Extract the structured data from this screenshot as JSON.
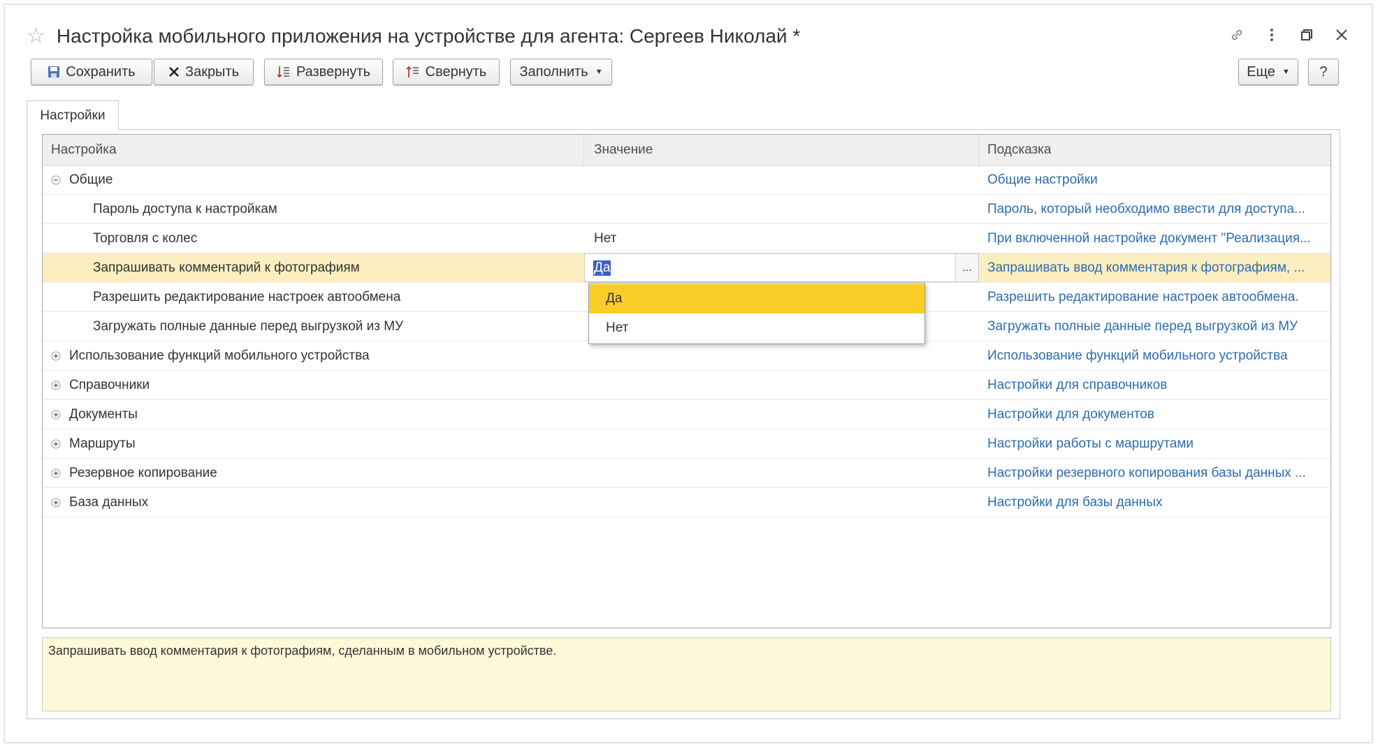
{
  "window": {
    "title": "Настройка мобильного приложения на устройстве для агента: Сергеев Николай *",
    "icons": [
      "star-icon",
      "link-icon",
      "more-vertical-icon",
      "restore-window-icon",
      "close-icon"
    ]
  },
  "toolbar": {
    "save_label": "Сохранить",
    "close_label": "Закрыть",
    "expand_label": "Развернуть",
    "collapse_label": "Свернуть",
    "fill_label": "Заполнить",
    "more_label": "Еще",
    "help_label": "?"
  },
  "tabs": [
    {
      "label": "Настройки"
    }
  ],
  "grid": {
    "columns": {
      "setting": "Настройка",
      "value": "Значение",
      "hint": "Подсказка"
    },
    "rows": [
      {
        "name": "Общие",
        "value": "",
        "hint": "Общие настройки",
        "level": 0,
        "state": "expanded"
      },
      {
        "name": "Пароль доступа к настройкам",
        "value": "",
        "hint": "Пароль, который необходимо ввести для доступа...",
        "level": 1
      },
      {
        "name": "Торговля с колес",
        "value": "Нет",
        "hint": "При включенной настройке документ \"Реализация...",
        "level": 1
      },
      {
        "name": "Запрашивать комментарий к фотографиям",
        "value": "Да",
        "hint": "Запрашивать ввод комментария к фотографиям, ...",
        "level": 1,
        "selected": true
      },
      {
        "name": "Разрешить редактирование настроек автообмена",
        "value": "",
        "hint": "Разрешить редактирование настроек автообмена.",
        "level": 1
      },
      {
        "name": "Загружать полные данные перед выгрузкой из МУ",
        "value": "",
        "hint": "Загружать полные данные перед выгрузкой из МУ",
        "level": 1
      },
      {
        "name": "Использование функций мобильного устройства",
        "value": "",
        "hint": "Использование функций мобильного устройства",
        "level": 0,
        "state": "collapsed"
      },
      {
        "name": "Справочники",
        "value": "",
        "hint": "Настройки для справочников",
        "level": 0,
        "state": "collapsed"
      },
      {
        "name": "Документы",
        "value": "",
        "hint": "Настройки для документов",
        "level": 0,
        "state": "collapsed"
      },
      {
        "name": "Маршруты",
        "value": "",
        "hint": "Настройки работы с маршрутами",
        "level": 0,
        "state": "collapsed"
      },
      {
        "name": "Резервное копирование",
        "value": "",
        "hint": "Настройки резервного копирования базы данных ...",
        "level": 0,
        "state": "collapsed"
      },
      {
        "name": "База данных",
        "value": "",
        "hint": "Настройки для базы данных",
        "level": 0,
        "state": "collapsed"
      }
    ],
    "editor": {
      "value": "Да",
      "choice_button": "..."
    },
    "dropdown": {
      "options": [
        "Да",
        "Нет"
      ],
      "active": "Да"
    }
  },
  "hint_box": {
    "text": "Запрашивать ввод комментария к фотографиям, сделанным в мобильном устройстве."
  },
  "colors": {
    "hint_link": "#2d6cae",
    "selected_row": "#fbeec0",
    "dropdown_active": "#f8cd26",
    "hint_box_bg": "#fdf9d9",
    "text_selection": "#3b5fc6"
  }
}
